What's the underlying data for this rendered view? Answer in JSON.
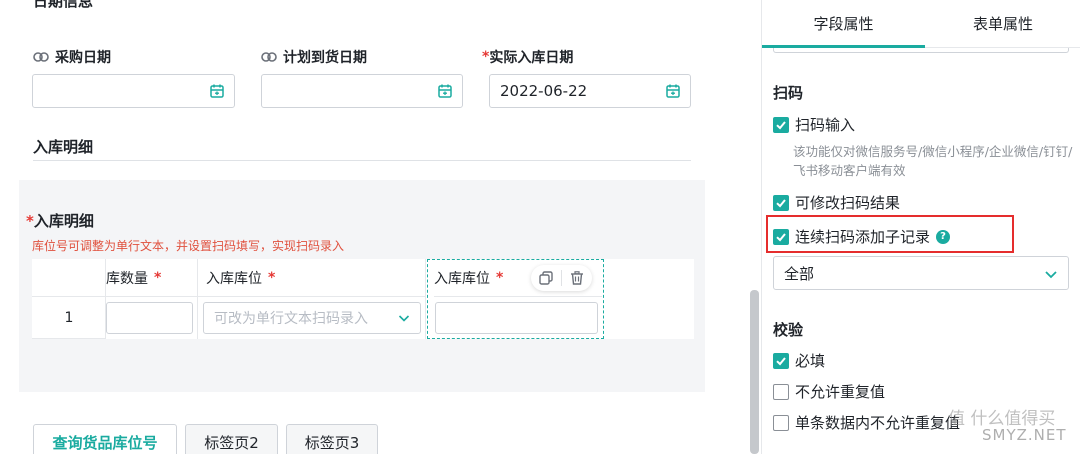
{
  "section_date": {
    "title": "日期信息"
  },
  "fields": {
    "purchase_date": {
      "label": "采购日期",
      "value": ""
    },
    "planned_arrival": {
      "label": "计划到货日期",
      "value": ""
    },
    "actual_in": {
      "required_mark": "*",
      "label": "实际入库日期",
      "value": "2022-06-22"
    }
  },
  "detail_section": {
    "title": "入库明细"
  },
  "subform": {
    "required_mark": "*",
    "title": "入库明细",
    "hint": "库位号可调整为单行文本，并设置扫码填写，实现扫码录入",
    "columns": [
      {
        "label": "库数量",
        "required": "*"
      },
      {
        "label": "入库库位",
        "required": "*"
      },
      {
        "label": "入库库位",
        "required": "*"
      }
    ],
    "rows": [
      {
        "index": "1",
        "select_placeholder": "可改为单行文本扫码录入"
      }
    ]
  },
  "tabs": [
    {
      "label": "查询货品库位号",
      "active": true
    },
    {
      "label": "标签页2",
      "active": false
    },
    {
      "label": "标签页3",
      "active": false
    }
  ],
  "panel": {
    "tabs": [
      {
        "label": "字段属性",
        "active": true
      },
      {
        "label": "表单属性",
        "active": false
      }
    ],
    "scan": {
      "title": "扫码",
      "scan_input": {
        "label": "扫码输入",
        "checked": true
      },
      "description": "该功能仅对微信服务号/微信小程序/企业微信/钉钉/飞书移动客户端有效",
      "editable_result": {
        "label": "可修改扫码结果",
        "checked": true
      },
      "continuous_add": {
        "label": "连续扫码添加子记录",
        "checked": true,
        "help_icon": "?"
      },
      "scope_select": {
        "value": "全部"
      }
    },
    "validation": {
      "title": "校验",
      "required": {
        "label": "必填",
        "checked": true
      },
      "no_duplicate": {
        "label": "不允许重复值",
        "checked": false
      },
      "no_dup_in_row": {
        "label": "单条数据内不允许重复值",
        "checked": false
      }
    }
  },
  "watermark": {
    "line1": "值 什么值得买",
    "line2": "SMYZ.NET"
  },
  "colors": {
    "accent": "#1aaba0",
    "required": "#e53935",
    "hint": "#e0513e",
    "highlight_box": "#e52d2d"
  }
}
